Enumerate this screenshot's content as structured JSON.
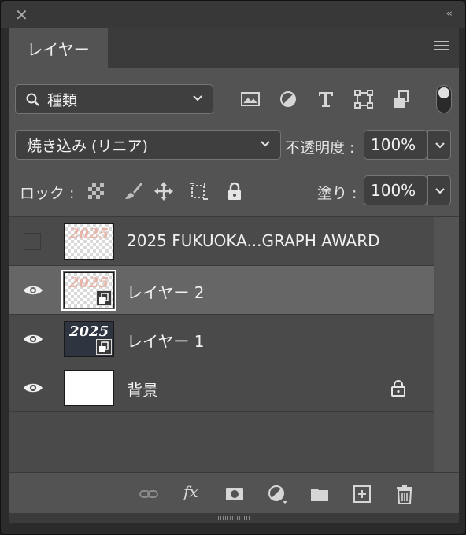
{
  "window": {
    "close_icon": "close-icon",
    "collapse_icon": "double-chevron-left-icon"
  },
  "panel": {
    "tab_label": "レイヤー",
    "menu_icon": "hamburger-menu-icon"
  },
  "filter": {
    "kind_label": "種類",
    "icons": [
      "image-filter-icon",
      "adjustment-filter-icon",
      "type-filter-icon",
      "shape-filter-icon",
      "smart-object-filter-icon"
    ]
  },
  "blend": {
    "mode": "焼き込み (リニア)",
    "opacity_label": "不透明度 :",
    "opacity_value": "100%"
  },
  "lock": {
    "label": "ロック :",
    "icons": [
      "lock-transparency-icon",
      "lock-image-icon",
      "lock-position-icon",
      "lock-artboard-icon",
      "lock-all-icon"
    ],
    "fill_label": "塗り :",
    "fill_value": "100%"
  },
  "layers": [
    {
      "name": "2025 FUKUOKA...GRAPH AWARD",
      "visible": false,
      "selected": false,
      "thumb": "2025",
      "thumb_bg": "checker"
    },
    {
      "name": "レイヤー 2",
      "visible": true,
      "selected": true,
      "thumb": "2025",
      "thumb_bg": "checker",
      "smart": true
    },
    {
      "name": "レイヤー 1",
      "visible": true,
      "selected": false,
      "thumb": "2025",
      "thumb_bg": "dark",
      "smart": true
    },
    {
      "name": "背景",
      "visible": true,
      "selected": false,
      "thumb": "",
      "thumb_bg": "white",
      "locked": true
    }
  ],
  "bottom": {
    "fx_label": "fx",
    "icons": [
      "link-layers-icon",
      "fx-icon",
      "add-mask-icon",
      "new-adjustment-layer-icon",
      "new-group-icon",
      "new-layer-icon",
      "delete-layer-icon"
    ]
  },
  "colors": {
    "panel_bg": "#535353",
    "selected_row": "#666666",
    "field_bg": "#3f3f3f"
  }
}
